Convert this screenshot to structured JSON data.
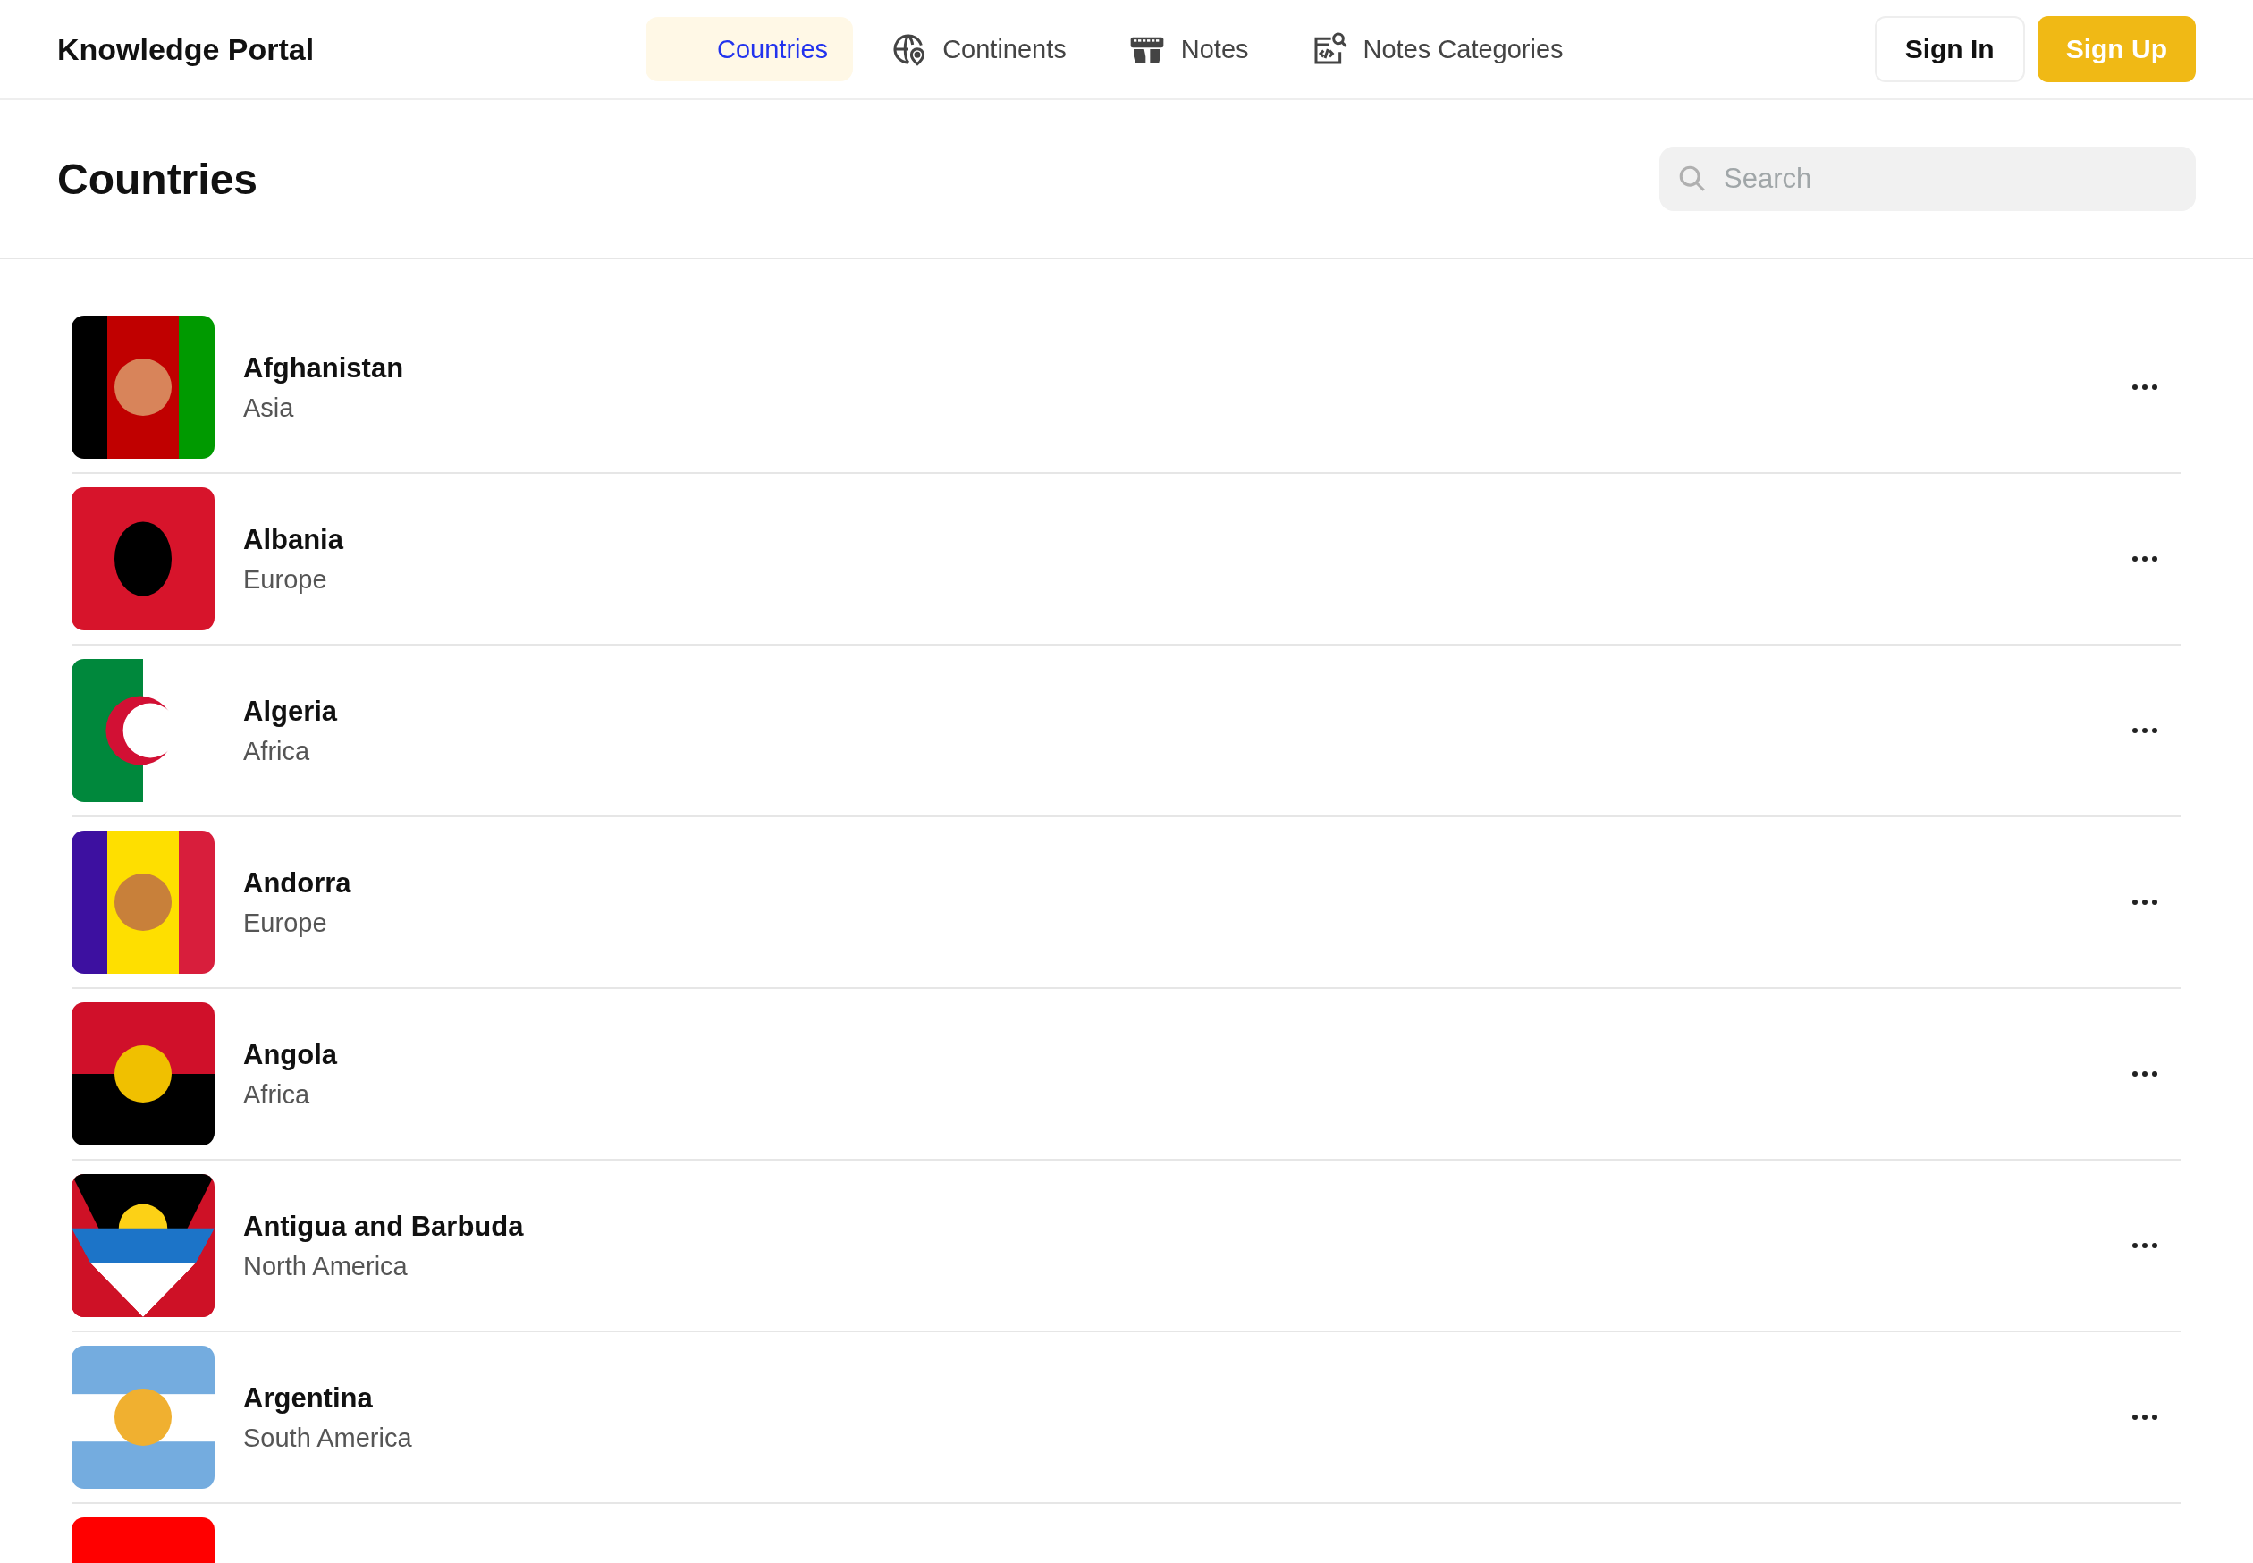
{
  "brand": "Knowledge Portal",
  "nav": [
    {
      "label": "Countries",
      "selected": true
    },
    {
      "label": "Continents",
      "selected": false
    },
    {
      "label": "Notes",
      "selected": false
    },
    {
      "label": "Notes Categories",
      "selected": false
    }
  ],
  "auth": {
    "sign_in": "Sign In",
    "sign_up": "Sign Up"
  },
  "page": {
    "title": "Countries",
    "search": {
      "placeholder": "Search"
    }
  },
  "countries": [
    {
      "name": "Afghanistan",
      "continent": "Asia",
      "flag": {
        "kind": "picture"
      }
    },
    {
      "name": "Albania",
      "continent": "Europe",
      "flag": {
        "kind": "picture"
      }
    },
    {
      "name": "Algeria",
      "continent": "Africa",
      "flag": {
        "kind": "picture"
      }
    },
    {
      "name": "Andorra",
      "continent": "Europe",
      "flag": {
        "kind": "picture"
      }
    },
    {
      "name": "Angola",
      "continent": "Africa",
      "flag": {
        "kind": "picture"
      }
    },
    {
      "name": "Antigua and Barbuda",
      "continent": "North America",
      "flag": {
        "kind": "picture"
      }
    },
    {
      "name": "Argentina",
      "continent": "South America",
      "flag": {
        "kind": "picture"
      }
    },
    {
      "flag": {
        "kind": "picture"
      }
    }
  ]
}
